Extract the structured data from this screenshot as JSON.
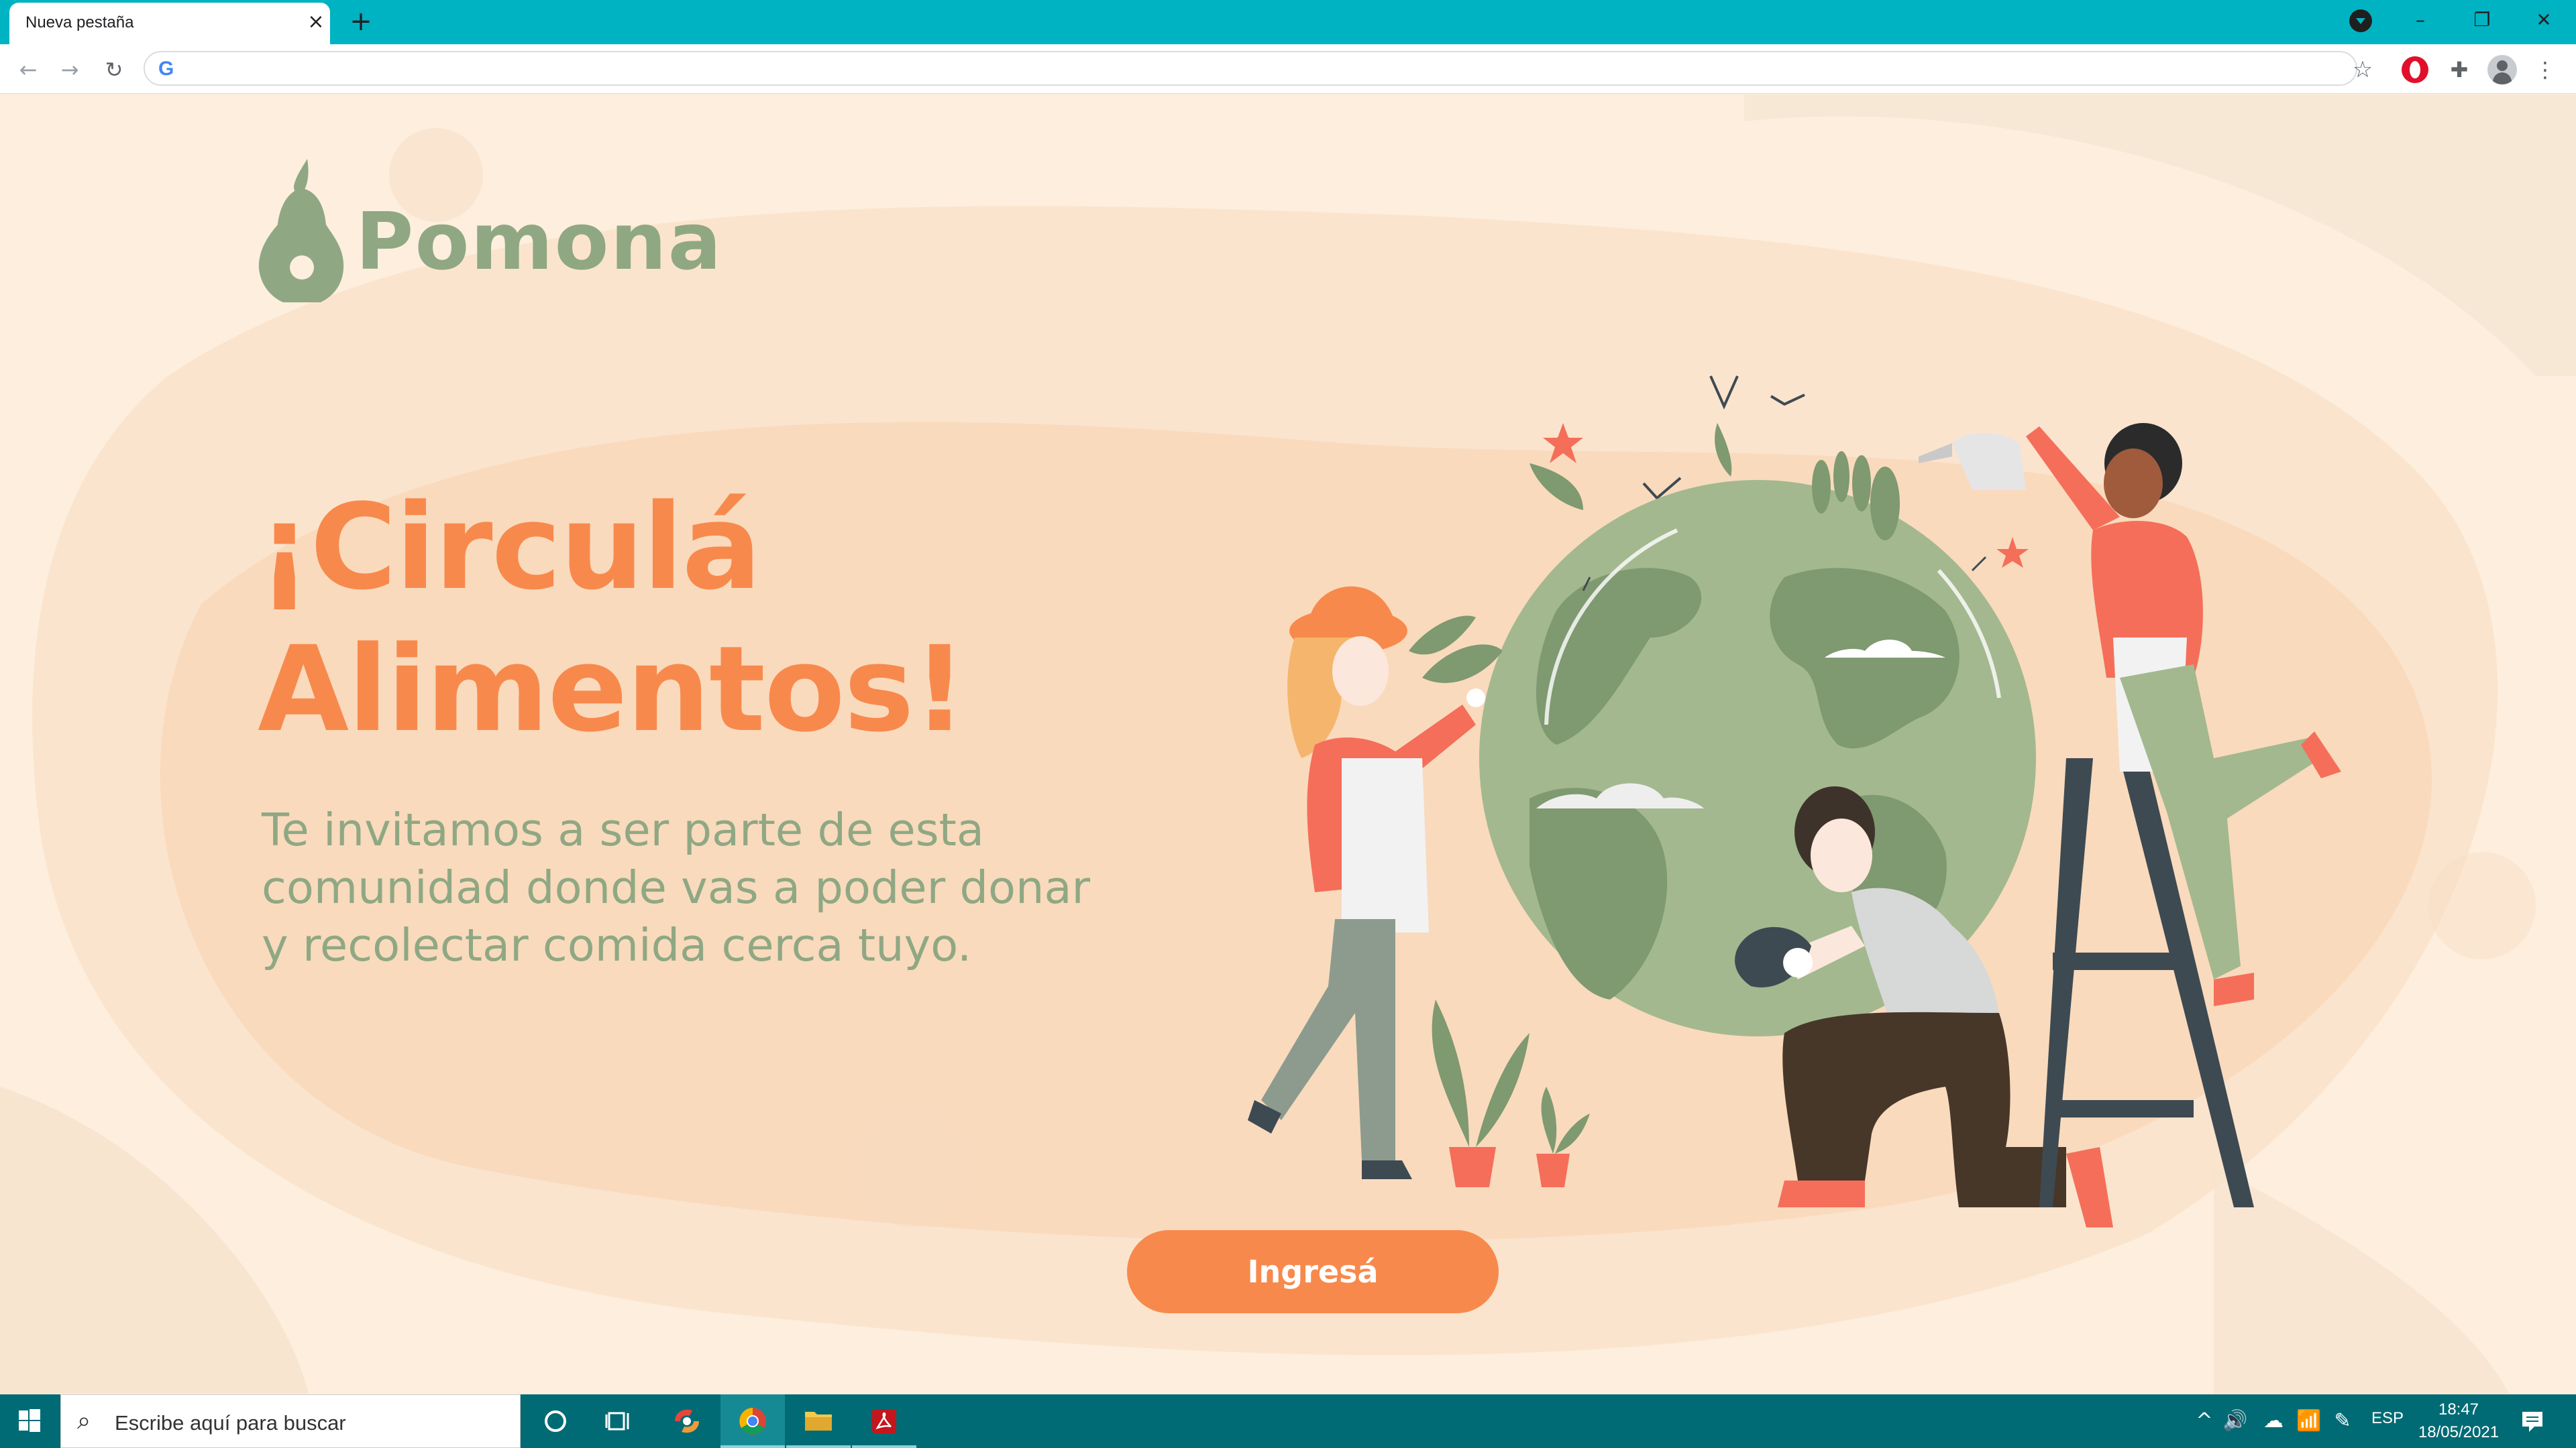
{
  "browser": {
    "tab_title": "Nueva pestaña",
    "tab_close_icon": "×",
    "new_tab_icon": "+",
    "window_controls": {
      "minimize": "–",
      "maximize": "❐",
      "close": "✕"
    },
    "toolbar": {
      "back_icon": "←",
      "forward_icon": "→",
      "reload_icon": "↻",
      "omnibox_value": "",
      "omnibox_icon": "G",
      "bookmark_icon": "☆",
      "extensions_icon": "✚",
      "menu_icon": "⋮"
    }
  },
  "page": {
    "logo_text": "Pomona",
    "headline_line1": "¡Circulá",
    "headline_line2": "Alimentos!",
    "subtitle_line1": "Te invitamos a ser parte de esta",
    "subtitle_line2": "comunidad donde vas a poder donar",
    "subtitle_line3": "y recolectar comida cerca tuyo.",
    "cta_label": "Ingresá",
    "colors": {
      "accent": "#f8894c",
      "green": "#8fa883",
      "background": "#fdeedd",
      "tabbar": "#00b3c2",
      "taskbar": "#006b74"
    }
  },
  "taskbar": {
    "search_placeholder": "Escribe aquí para buscar",
    "pinned_apps": [
      "cortana",
      "task-view",
      "app",
      "chrome",
      "file-explorer",
      "acrobat-reader"
    ],
    "tray": {
      "chevron": "^",
      "volume_icon": "🔊",
      "cloud_icon": "☁",
      "network_icon": "📶",
      "pen_icon": "✎",
      "language": "ESP",
      "time": "18:47",
      "date": "18/05/2021"
    }
  }
}
